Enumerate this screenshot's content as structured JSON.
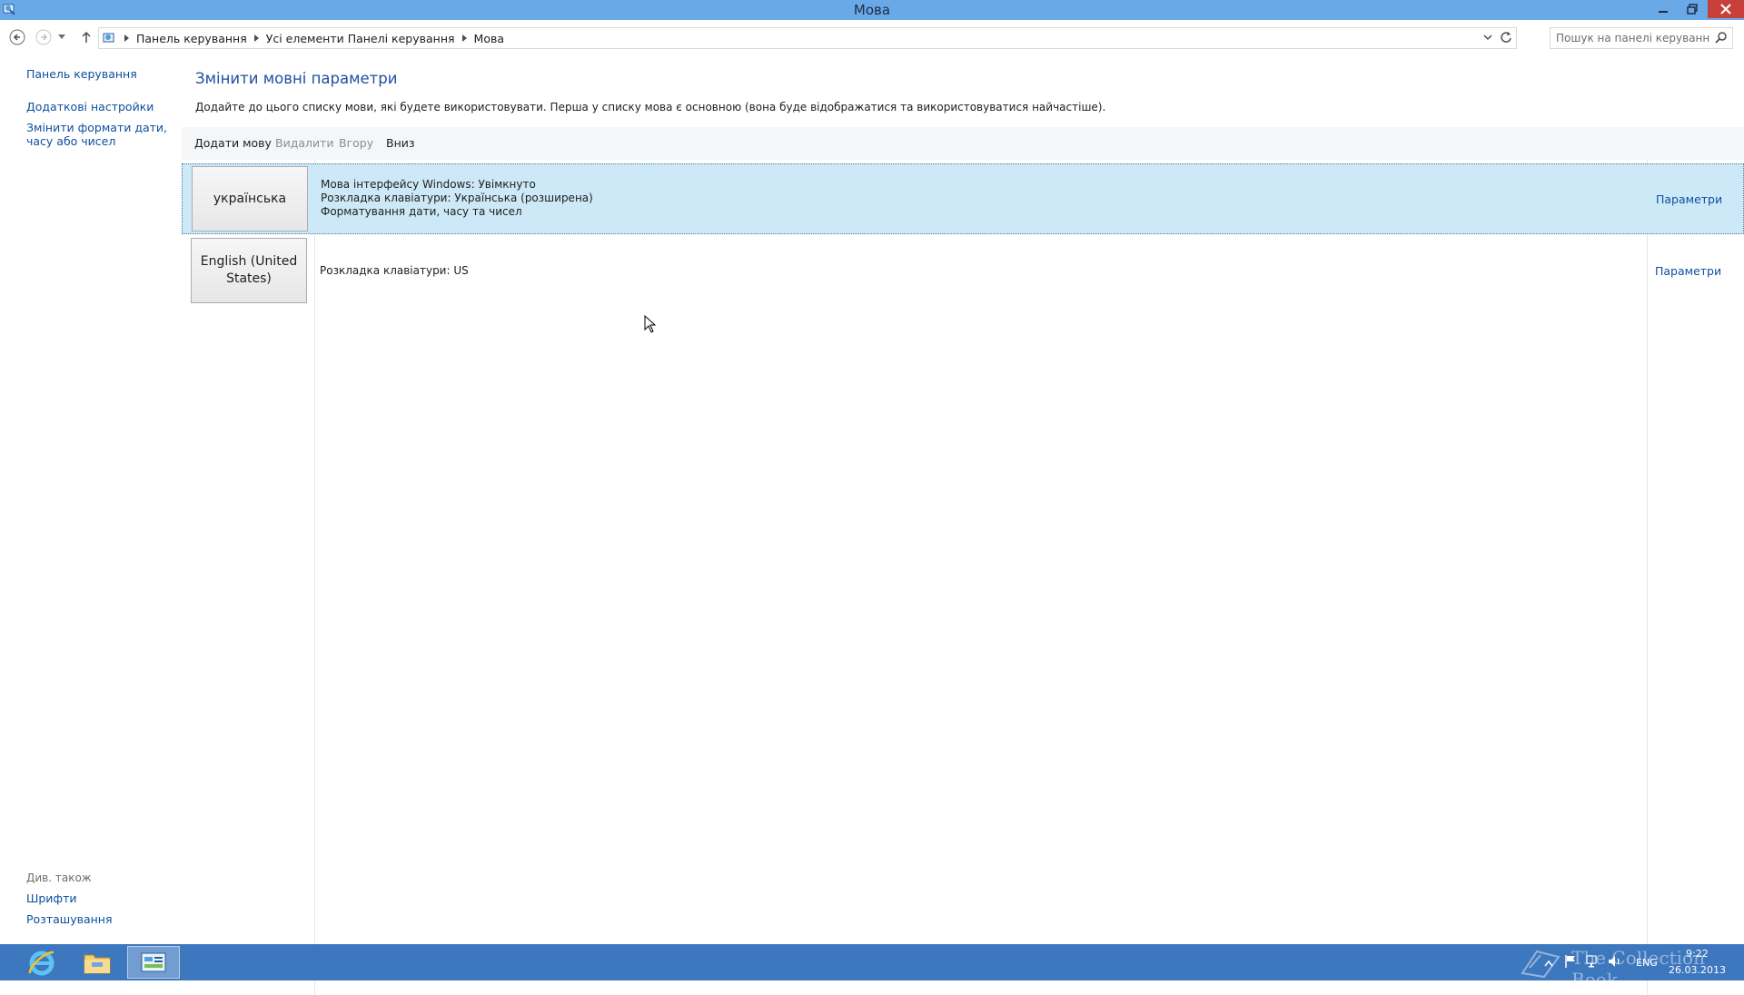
{
  "window": {
    "title": "Мова"
  },
  "address": {
    "breadcrumbs": [
      "Панель керування",
      "Усі елементи Панелі керування",
      "Мова"
    ]
  },
  "search": {
    "placeholder": "Пошук на панелі керування"
  },
  "leftnav": {
    "home": "Панель керування",
    "advanced": "Додаткові настройки",
    "formats": "Змінити формати дати, часу або чисел",
    "see_also": "Див. також",
    "fonts": "Шрифти",
    "location": "Розташування"
  },
  "main": {
    "heading": "Змінити мовні параметри",
    "description": "Додайте до цього списку мови, які будете використовувати. Перша у списку мова є основною (вона буде відображатися та використовуватися найчастіше).",
    "toolbar": {
      "add": "Додати мову",
      "remove": "Видалити",
      "up": "Вгору",
      "down": "Вниз"
    },
    "languages": [
      {
        "name": "українська",
        "details": [
          "Мова інтерфейсу Windows: Увімкнуто",
          "Розкладка клавіатури: Українська (розширена)",
          "Форматування дати, часу та чисел"
        ],
        "options": "Параметри"
      },
      {
        "name": "English (United States)",
        "details": [
          "Розкладка клавіатури: US"
        ],
        "options": "Параметри"
      }
    ]
  },
  "taskbar": {
    "lang": "ENG",
    "time": "9:22",
    "date": "26.03.2013"
  },
  "watermark": "The Collection Book",
  "colors": {
    "titlebar": "#6aa9e8",
    "taskbar": "#3d77be",
    "link": "#0d4f9e",
    "selected_row": "#cde8f6",
    "close_button": "#c7403a"
  }
}
